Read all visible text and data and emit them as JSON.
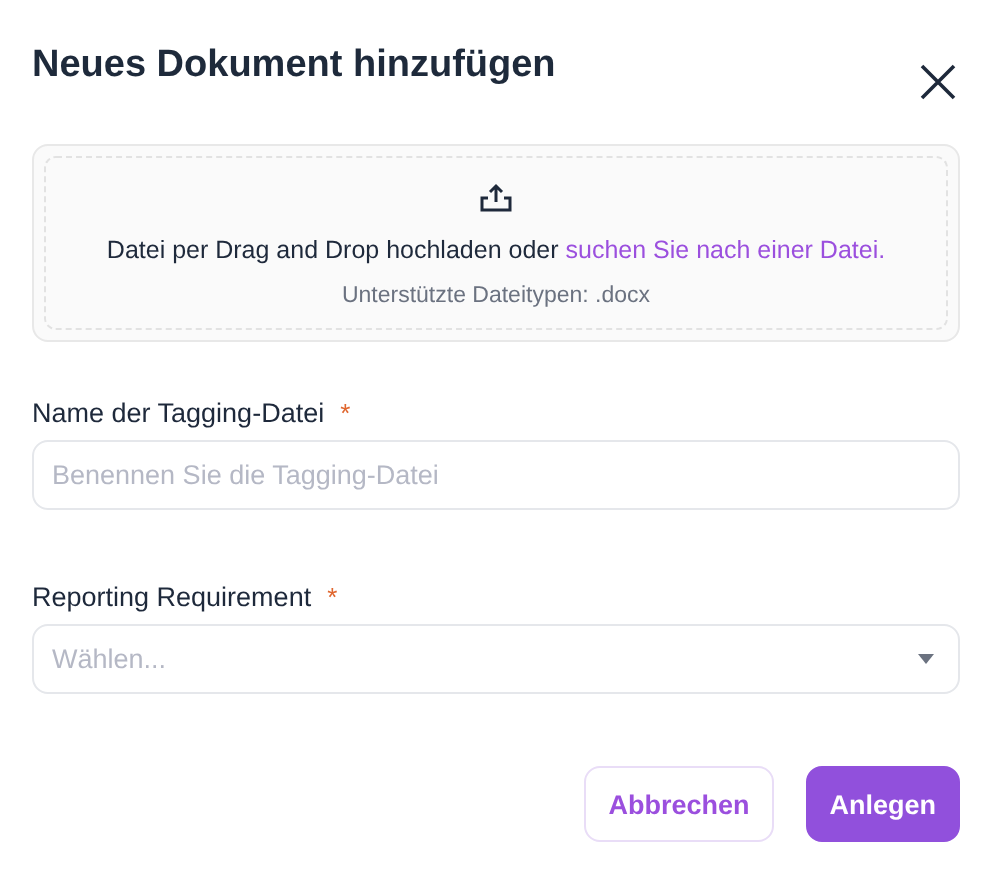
{
  "dialog": {
    "title": "Neues Dokument hinzufügen"
  },
  "dropzone": {
    "text": "Datei per Drag and Drop hochladen oder",
    "link": "suchen Sie nach einer Datei.",
    "hint": "Unterstützte Dateitypen: .docx"
  },
  "fields": [
    {
      "kind": "text",
      "label": "Name der Tagging-Datei",
      "required_mark": "*",
      "placeholder": "Benennen Sie die Tagging-Datei"
    },
    {
      "kind": "select",
      "label": "Reporting Requirement",
      "required_mark": "*",
      "placeholder": "Wählen..."
    }
  ],
  "buttons": [
    {
      "label": "Abbrechen",
      "kind": "secondary"
    },
    {
      "label": "Anlegen",
      "kind": "primary"
    }
  ]
}
